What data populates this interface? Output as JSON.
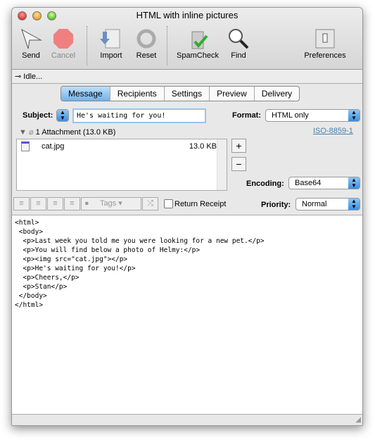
{
  "window": {
    "title": "HTML with inline pictures"
  },
  "toolbar": {
    "send": "Send",
    "cancel": "Cancel",
    "import": "Import",
    "reset": "Reset",
    "spamcheck": "SpamCheck",
    "find": "Find",
    "preferences": "Preferences"
  },
  "status": "Idle...",
  "tabs": [
    "Message",
    "Recipients",
    "Settings",
    "Preview",
    "Delivery"
  ],
  "subject": {
    "label": "Subject:",
    "value": "He's waiting for you!"
  },
  "format": {
    "label": "Format:",
    "value": "HTML only"
  },
  "charset": "ISO-8859-1",
  "attachments": {
    "header": "1 Attachment (13.0 KB)",
    "items": [
      {
        "name": "cat.jpg",
        "size": "13.0 KB"
      }
    ]
  },
  "buttons": {
    "add": "+",
    "remove": "−"
  },
  "encoding": {
    "label": "Encoding:",
    "value": "Base64"
  },
  "tags": "Tags",
  "return_receipt": {
    "label": "Return Receipt",
    "checked": false
  },
  "priority": {
    "label": "Priority:",
    "value": "Normal"
  },
  "body_lines": [
    "<html>",
    " <body>",
    "  <p>Last week you told me you were looking for a new pet.</p>",
    "  <p>You will find below a photo of Helmy:</p>",
    "  <p><img src=\"cat.jpg\"></p>",
    "  <p>He's waiting for you!</p>",
    "  <p>Cheers,</p>",
    "  <p>Stan</p>",
    " </body>",
    "</html>"
  ]
}
